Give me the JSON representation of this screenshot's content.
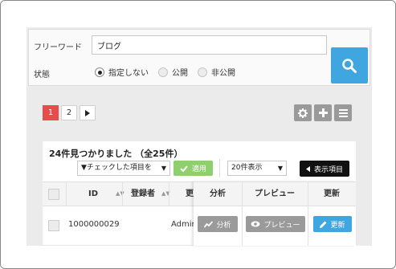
{
  "search": {
    "keyword_label": "フリーワード",
    "keyword_value": "ブログ",
    "status_label": "状態",
    "status_options": [
      {
        "label": "指定しない",
        "checked": true
      },
      {
        "label": "公開",
        "checked": false
      },
      {
        "label": "非公開",
        "checked": false
      }
    ],
    "search_icon": "search-icon"
  },
  "pager": {
    "pages": [
      "1",
      "2"
    ],
    "current": "1",
    "next_icon": "caret-right-icon"
  },
  "tools": [
    "gear-icon",
    "plus-icon",
    "menu-icon"
  ],
  "result": {
    "count_text": "24件見つかりました （全25件）",
    "bulk_action": "▼チェックした項目を",
    "apply_label": "適用",
    "per_page": "20件表示",
    "columns_label": "表示項目"
  },
  "table": {
    "headers": {
      "id": "ID",
      "author": "登録者",
      "updated": "更",
      "analysis": "分析",
      "preview": "プレビュー",
      "update": "更新"
    },
    "rows": [
      {
        "id": "1000000029",
        "author": "",
        "updated": "Admin",
        "analysis_label": "分析",
        "preview_label": "プレビュー",
        "update_label": "更新"
      }
    ]
  },
  "colors": {
    "accent": "#3fa6df",
    "pager_active": "#e84c4c",
    "apply": "#8fcf6d",
    "action_gray": "#9a9a9a"
  }
}
